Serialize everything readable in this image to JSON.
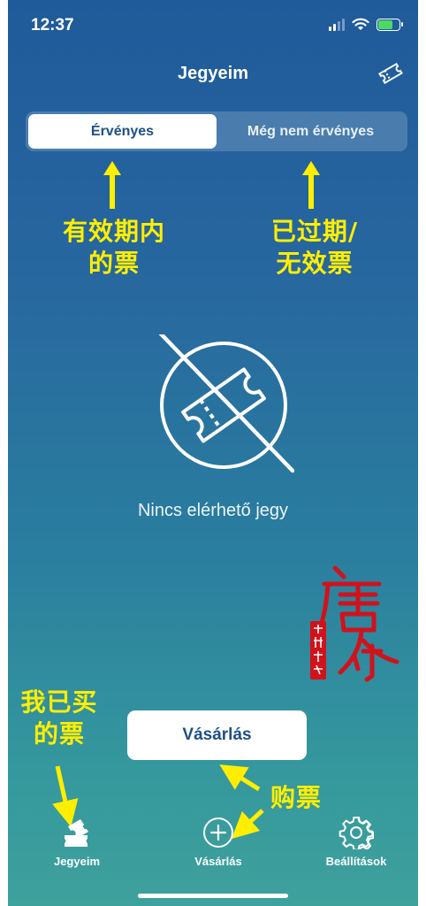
{
  "status_bar": {
    "time": "12:37"
  },
  "header": {
    "title": "Jegyeim"
  },
  "segments": [
    {
      "label": "Érvényes",
      "active": true
    },
    {
      "label": "Még nem érvényes",
      "active": false
    }
  ],
  "annotations": {
    "valid_line1": "有效期内",
    "valid_line2": "的票",
    "expired_line1": "已过期/",
    "expired_line2": "无效票",
    "mine_line1": "我已买",
    "mine_line2": "的票",
    "buy": "购票"
  },
  "empty_state": {
    "message": "Nincs elérhető jegy"
  },
  "buy_button": {
    "label": "Vásárlás"
  },
  "tabs": [
    {
      "label": "Jegyeim",
      "icon": "tickets-icon"
    },
    {
      "label": "Vásárlás",
      "icon": "plus-circle-icon"
    },
    {
      "label": "Beállítások",
      "icon": "gear-icon"
    }
  ],
  "colors": {
    "accent_yellow": "#ffee00",
    "brand_blue": "#1d4f86"
  }
}
